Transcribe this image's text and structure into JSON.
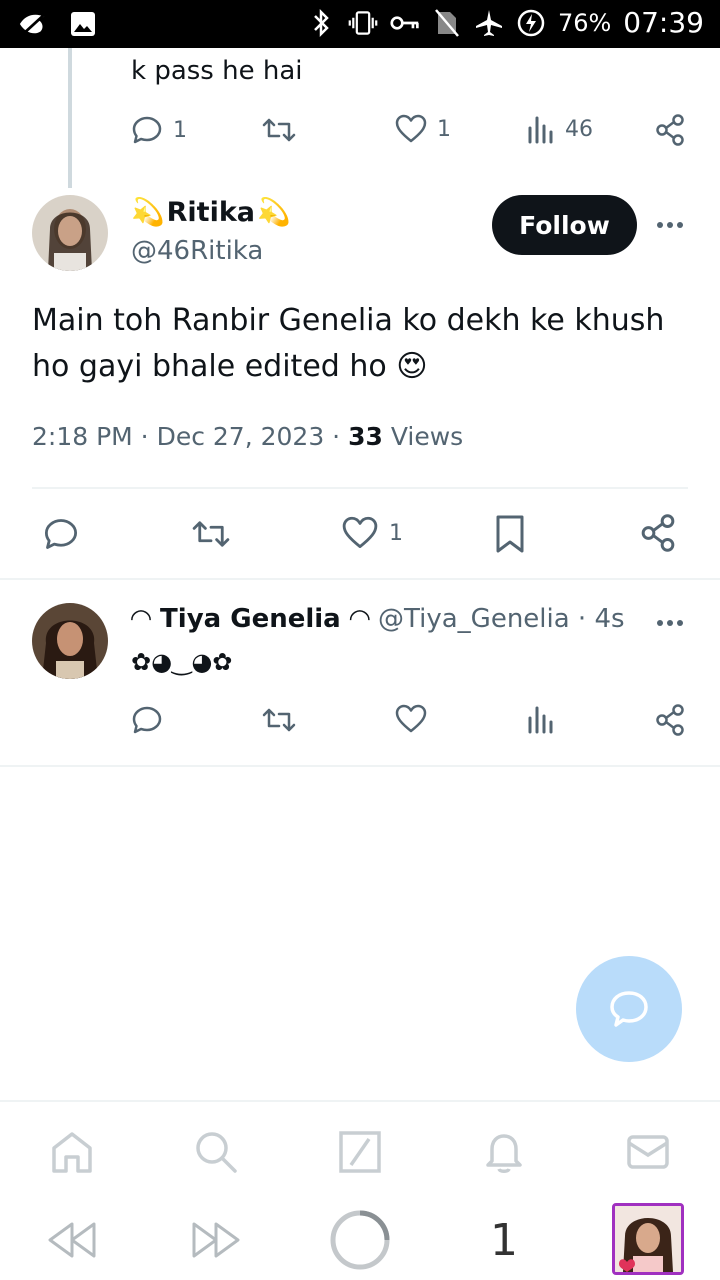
{
  "status_bar": {
    "battery": "76%",
    "time": "07:39"
  },
  "prev_tweet": {
    "text_tail": "k pass he hai",
    "replies": "1",
    "likes": "1",
    "views": "46"
  },
  "main_tweet": {
    "display_name": "Ritika",
    "name_emoji_left": "💫",
    "name_emoji_right": "💫",
    "handle": "@46Ritika",
    "follow_label": "Follow",
    "text": "Main toh Ranbir Genelia ko dekh ke khush ho gayi bhale edited ho 😍",
    "time": "2:18 PM",
    "date": "Dec 27, 2023",
    "views_count": "33",
    "views_label": "Views",
    "likes": "1"
  },
  "reply": {
    "name_prefix": "◠ ",
    "display_name": "Tiya Genelia",
    "name_suffix": " ◠",
    "handle": "@Tiya_Genelia",
    "age": "4s",
    "text": "✿◕‿◕✿"
  },
  "browser": {
    "tab_count": "1"
  },
  "colors": {
    "text": "#0f1419",
    "muted": "#536471",
    "divider": "#eff3f4",
    "fab": "#b9dcfa",
    "follow_bg": "#0f1419"
  }
}
